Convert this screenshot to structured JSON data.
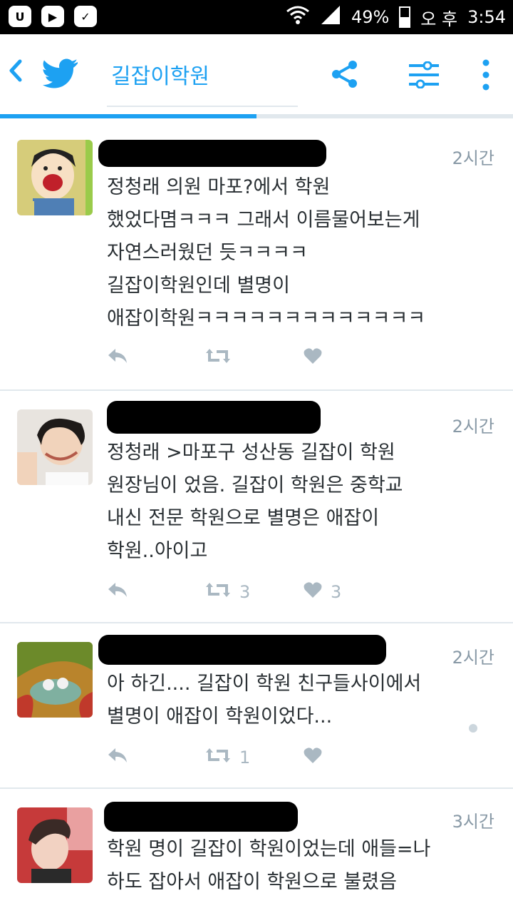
{
  "status": {
    "battery": "49%",
    "ampm": "오 후",
    "time": "3:54"
  },
  "header": {
    "title": "길잡이학원",
    "progress": 0.5
  },
  "colors": {
    "accent": "#1da1f2",
    "meta": "#8899a6",
    "action": "#aab8c2"
  },
  "tweets": [
    {
      "time": "2시간",
      "text": "정청래 의원 마포?에서 학원\n했었다몀ㅋㅋㅋ 그래서 이름물어보는게\n자연스러웠던 듯ㅋㅋㅋㅋ\n길잡이학원인데 별명이\n애잡이학원ㅋㅋㅋㅋㅋㅋㅋㅋㅋㅋㅋㅋㅋ",
      "retweets": "",
      "likes": ""
    },
    {
      "time": "2시간",
      "text": "정청래 >마포구 성산동 길잡이 학원\n원장님이 었음. 길잡이 학원은 중학교\n내신 전문 학원으로 별명은 애잡이\n학원..아이고",
      "retweets": "3",
      "likes": "3"
    },
    {
      "time": "2시간",
      "text": "아 하긴.... 길잡이 학원 친구들사이에서\n별명이 애잡이 학원이었다...",
      "retweets": "1",
      "likes": ""
    },
    {
      "time": "3시간",
      "text": "학원 명이 길잡이 학원이었는데 애들=나\n하도 잡아서 애잡이 학원으로 불렸음",
      "retweets": "",
      "likes": ""
    }
  ]
}
